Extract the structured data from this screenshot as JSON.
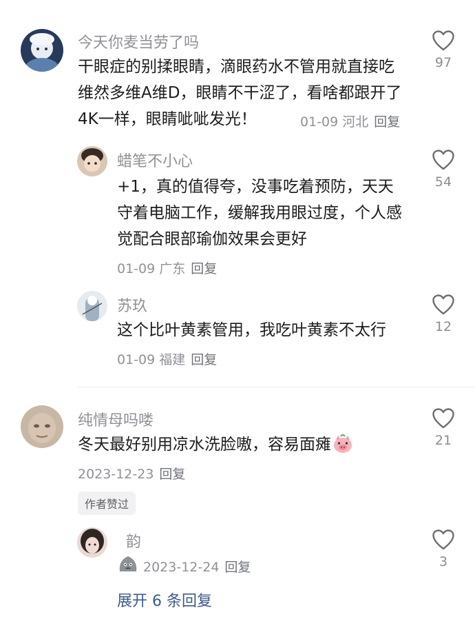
{
  "comments": [
    {
      "user": "今天你麦当劳了吗",
      "text": "干眼症的别揉眼睛，滴眼药水不管用就直接吃维然多维A维D，眼睛不干涩了，看啥都跟开了4K一样，眼睛呲呲发光！",
      "meta": "01-09 河北",
      "reply": "回复",
      "likes": "97",
      "replies": [
        {
          "user": "蜡笔不小心",
          "text": "+1，真的值得夸，没事吃着预防，天天守着电脑工作，缓解我用眼过度，个人感觉配合眼部瑜伽效果会更好",
          "meta": "01-09 广东",
          "reply": "回复",
          "likes": "54"
        },
        {
          "user": "苏玖",
          "text": "这个比叶黄素管用，我吃叶黄素不太行",
          "meta": "01-09 福建",
          "reply": "回复",
          "likes": "12"
        }
      ]
    },
    {
      "user": "纯情母吗喽",
      "text": "冬天最好别用凉水洗脸嗷，容易面瘫",
      "emoji": "pig-face-emoji",
      "meta": "2023-12-23",
      "reply": "回复",
      "likes": "21",
      "badge": "作者赞过",
      "replies": [
        {
          "user": "韵",
          "sticker": "grey-blob-sticker",
          "meta": "2023-12-24",
          "reply": "回复",
          "likes": "3"
        }
      ],
      "expand": "展开 6 条回复"
    }
  ],
  "colors": {
    "muted": "#8f9197",
    "link": "#3c5a8a",
    "text": "#1c1c1c"
  }
}
